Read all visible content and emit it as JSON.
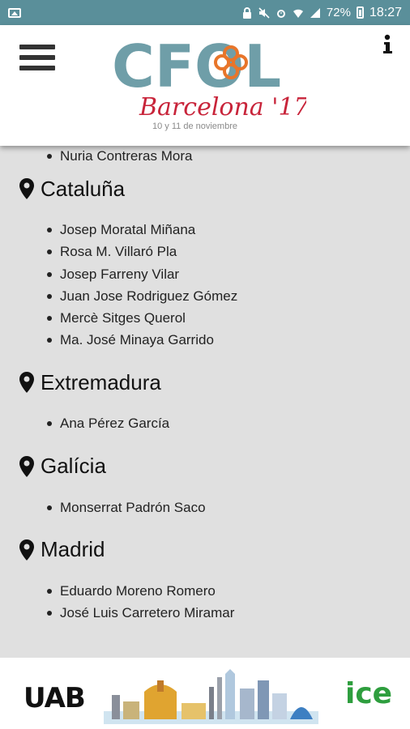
{
  "status_bar": {
    "battery": "72%",
    "time": "18:27"
  },
  "header": {
    "logo_text": "CFOL",
    "logo_subtitle": "Barcelona '17",
    "logo_dates": "10 y 11 de noviembre",
    "brand_colors": {
      "teal": "#6f9ea8",
      "orange": "#e8752a",
      "red": "#c8243a"
    }
  },
  "content": {
    "orphan_items": [
      "Nuria Contreras Mora"
    ],
    "regions": [
      {
        "name": "Cataluña",
        "members": [
          "Josep Moratal Miñana",
          "Rosa M. Villaró Pla",
          "Josep Farreny Vilar",
          "Juan Jose Rodriguez Gómez",
          "Mercè Sitges Querol",
          "Ma. José Minaya Garrido"
        ]
      },
      {
        "name": "Extremadura",
        "members": [
          "Ana Pérez García"
        ]
      },
      {
        "name": "Galícia",
        "members": [
          "Monserrat Padrón Saco"
        ]
      },
      {
        "name": "Madrid",
        "members": [
          "Eduardo Moreno Romero",
          "José Luis Carretero Miramar"
        ]
      }
    ]
  },
  "footer": {
    "left_logo": "UAB",
    "right_logo": "ice",
    "icons": [
      "uab-logo",
      "barcelona-skyline-illustration",
      "ice-logo"
    ]
  }
}
